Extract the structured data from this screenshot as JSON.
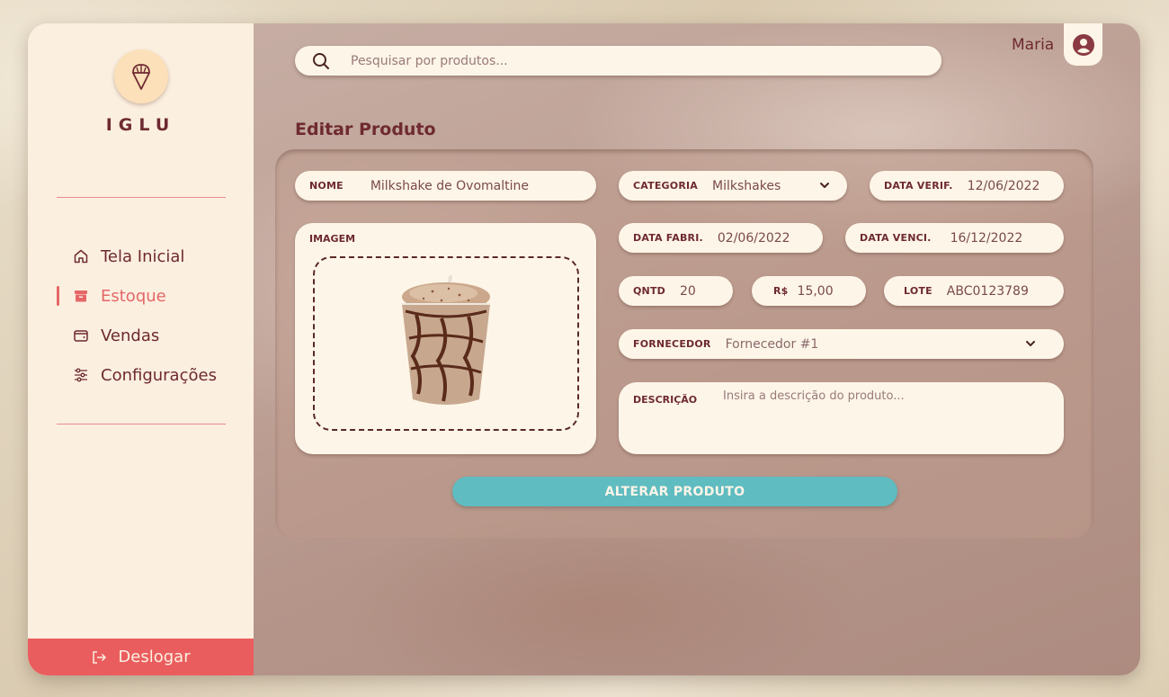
{
  "brand": {
    "name": "IGLU"
  },
  "sidebar": {
    "items": [
      {
        "label": "Tela Inicial",
        "icon": "home-icon",
        "active": false
      },
      {
        "label": "Estoque",
        "icon": "archive-icon",
        "active": true
      },
      {
        "label": "Vendas",
        "icon": "wallet-icon",
        "active": false
      },
      {
        "label": "Configurações",
        "icon": "sliders-icon",
        "active": false
      }
    ],
    "logout_label": "Deslogar"
  },
  "header": {
    "search_placeholder": "Pesquisar por produtos...",
    "user_name": "Maria"
  },
  "form": {
    "title": "Editar Produto",
    "nome": {
      "label": "NOME",
      "value": "Milkshake de Ovomaltine"
    },
    "categoria": {
      "label": "CATEGORIA",
      "value": "Milkshakes"
    },
    "data_verif": {
      "label": "DATA VERIF.",
      "value": "12/06/2022"
    },
    "imagem": {
      "label": "IMAGEM"
    },
    "data_fabri": {
      "label": "DATA FABRI.",
      "value": "02/06/2022"
    },
    "data_venci": {
      "label": "DATA VENCI.",
      "value": "16/12/2022"
    },
    "qntd": {
      "label": "QNTD",
      "value": "20"
    },
    "preco": {
      "label": "R$",
      "value": "15,00"
    },
    "lote": {
      "label": "LOTE",
      "value": "ABC0123789"
    },
    "fornecedor": {
      "label": "FORNECEDOR",
      "value": "Fornecedor #1"
    },
    "descricao": {
      "label": "DESCRIÇÃO",
      "placeholder": "Insira a descrição do produto..."
    },
    "submit_label": "ALTERAR PRODUTO"
  },
  "colors": {
    "accent": "#ea5d5e",
    "primary_text": "#6e2a30",
    "button": "#5fbcc0",
    "field_bg": "#fdf5e8"
  }
}
